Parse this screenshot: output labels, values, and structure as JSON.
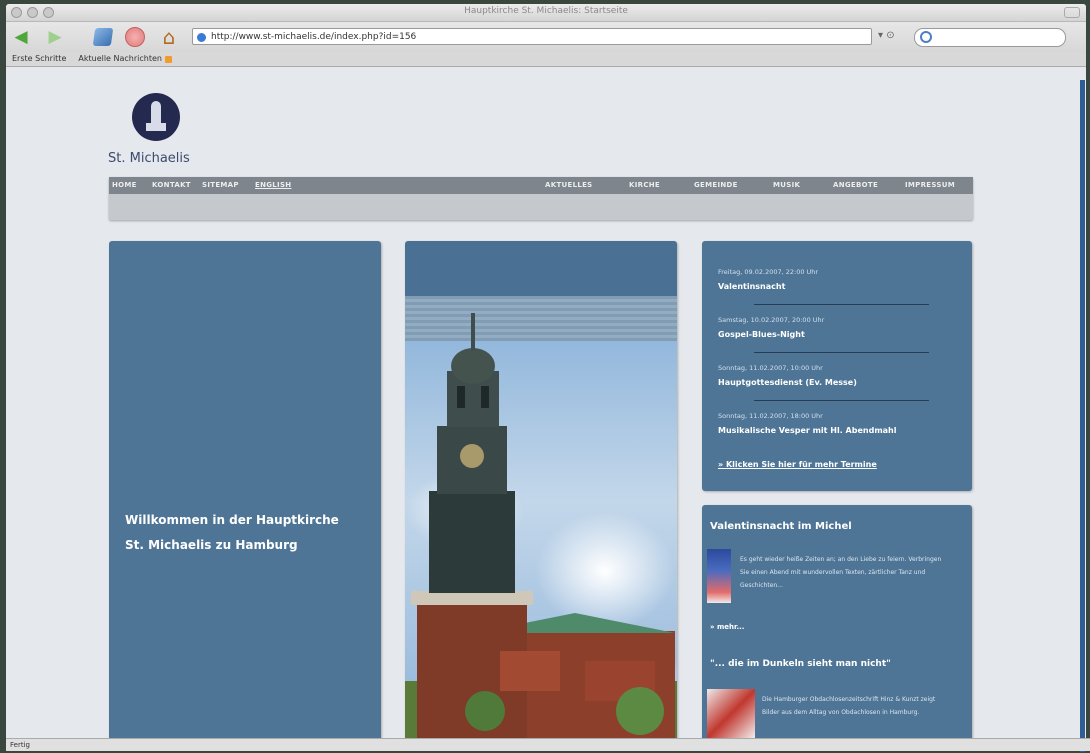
{
  "window": {
    "title": "Hauptkirche St. Michaelis: Startseite"
  },
  "toolbar": {
    "url": "http://www.st-michaelis.de/index.php?id=156"
  },
  "bookmarks": [
    "Erste Schritte",
    "Aktuelle Nachrichten"
  ],
  "site": {
    "logo_text": "St. Michaelis",
    "nav_left": [
      "HOME",
      "KONTAKT",
      "SITEMAP",
      "ENGLISH"
    ],
    "nav_right": [
      "AKTUELLES",
      "KIRCHE",
      "GEMEINDE",
      "MUSIK",
      "ANGEBOTE",
      "IMPRESSUM"
    ],
    "welcome": "Willkommen in der Hauptkirche St. Michaelis zu Hamburg",
    "events": [
      {
        "date": "Freitag, 09.02.2007, 22:00 Uhr",
        "title": "Valentinsnacht"
      },
      {
        "date": "Samstag, 10.02.2007, 20:00 Uhr",
        "title": "Gospel-Blues-Night"
      },
      {
        "date": "Sonntag, 11.02.2007, 10:00 Uhr",
        "title": "Hauptgottesdienst (Ev. Messe)"
      },
      {
        "date": "Sonntag, 11.02.2007, 18:00 Uhr",
        "title": "Musikalische Vesper mit Hl. Abendmahl"
      }
    ],
    "events_more": "» Klicken Sie hier für mehr Termine",
    "news1_title": "Valentinsnacht im Michel",
    "news1_text": "Es geht wieder heiße Zeiten an; an den Liebe zu feiern. Verbringen Sie einen Abend mit wundervollen Texten, zärtlicher Tanz und Geschichten...",
    "news1_more": "» mehr...",
    "news2_title": "\"... die im Dunkeln sieht man nicht\"",
    "news2_text": "Die Hamburger Obdachlosenzeitschrift Hinz & Kunzt zeigt Bilder aus dem Alltag von Obdachlosen in Hamburg."
  },
  "status": {
    "text": "Fertig"
  }
}
